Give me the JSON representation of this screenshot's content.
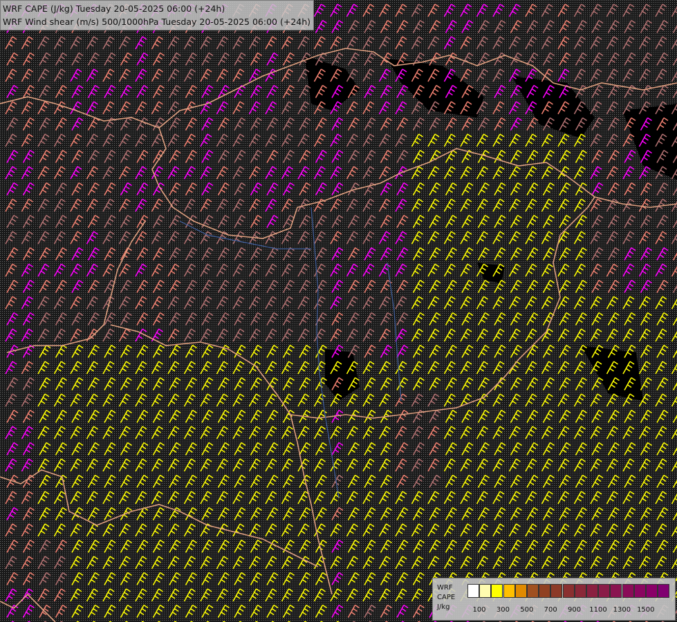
{
  "titles": {
    "line1": "WRF CAPE (J/kg) Tuesday 20-05-2025 06:00 (+24h)",
    "line2": "WRF Wind shear (m/s) 500/1000hPa Tuesday 20-05-2025 06:00 (+24h)"
  },
  "legend": {
    "line1": "WRF",
    "line2": "CAPE",
    "line3": "J/kg",
    "swatches": [
      "#ffffff",
      "#fffcb0",
      "#ffff00",
      "#ffc000",
      "#e08a00",
      "#a05020",
      "#904020",
      "#8c3a28",
      "#8a3030",
      "#8a2838",
      "#8a2040",
      "#8a1c48",
      "#8a1450",
      "#8a0c58",
      "#8a0660",
      "#8a0068",
      "#800070"
    ],
    "ticks": [
      "100",
      "300",
      "500",
      "700",
      "900",
      "1100",
      "1300",
      "1500"
    ]
  },
  "colors": {
    "background": "#000000",
    "barb_pink": "#ff00ff",
    "barb_salmon": "#f08070",
    "barb_brown": "#b07070",
    "barb_yellow": "#ffff00",
    "border_line": "#e0a080",
    "river_line": "#4060a0"
  }
}
